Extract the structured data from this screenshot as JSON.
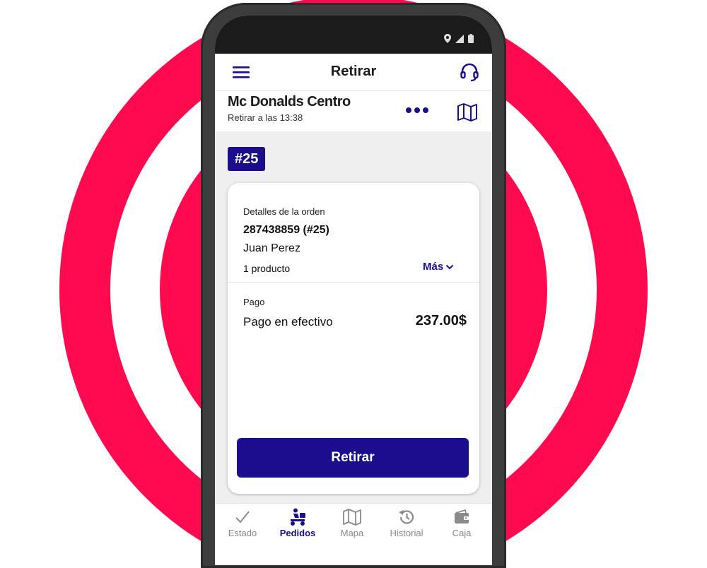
{
  "colors": {
    "accent": "#1a0e8f",
    "ring": "#ff0a4e",
    "phone_frame": "#3c3c3c"
  },
  "appbar": {
    "title": "Retirar",
    "menu_icon": "hamburger-menu-icon",
    "support_icon": "headset-icon"
  },
  "store": {
    "name": "Mc Donalds Centro",
    "pickup_time": "Retirar a las 13:38",
    "more_icon": "more-dots-icon",
    "map_icon": "map-icon"
  },
  "order_badge": "#25",
  "card": {
    "details_label": "Detalles de la orden",
    "order_id": "287438859 (#25)",
    "customer": "Juan Perez",
    "product_count": "1 producto",
    "more_label": "Más",
    "payment_label": "Pago",
    "payment_method": "Pago en efectivo",
    "payment_amount": "237.00$",
    "action_label": "Retirar"
  },
  "nav": [
    {
      "label": "Estado",
      "icon": "check-icon",
      "active": false
    },
    {
      "label": "Pedidos",
      "icon": "delivery-scooter-icon",
      "active": true
    },
    {
      "label": "Mapa",
      "icon": "map-icon",
      "active": false
    },
    {
      "label": "Historial",
      "icon": "history-icon",
      "active": false
    },
    {
      "label": "Caja",
      "icon": "wallet-icon",
      "active": false
    }
  ]
}
